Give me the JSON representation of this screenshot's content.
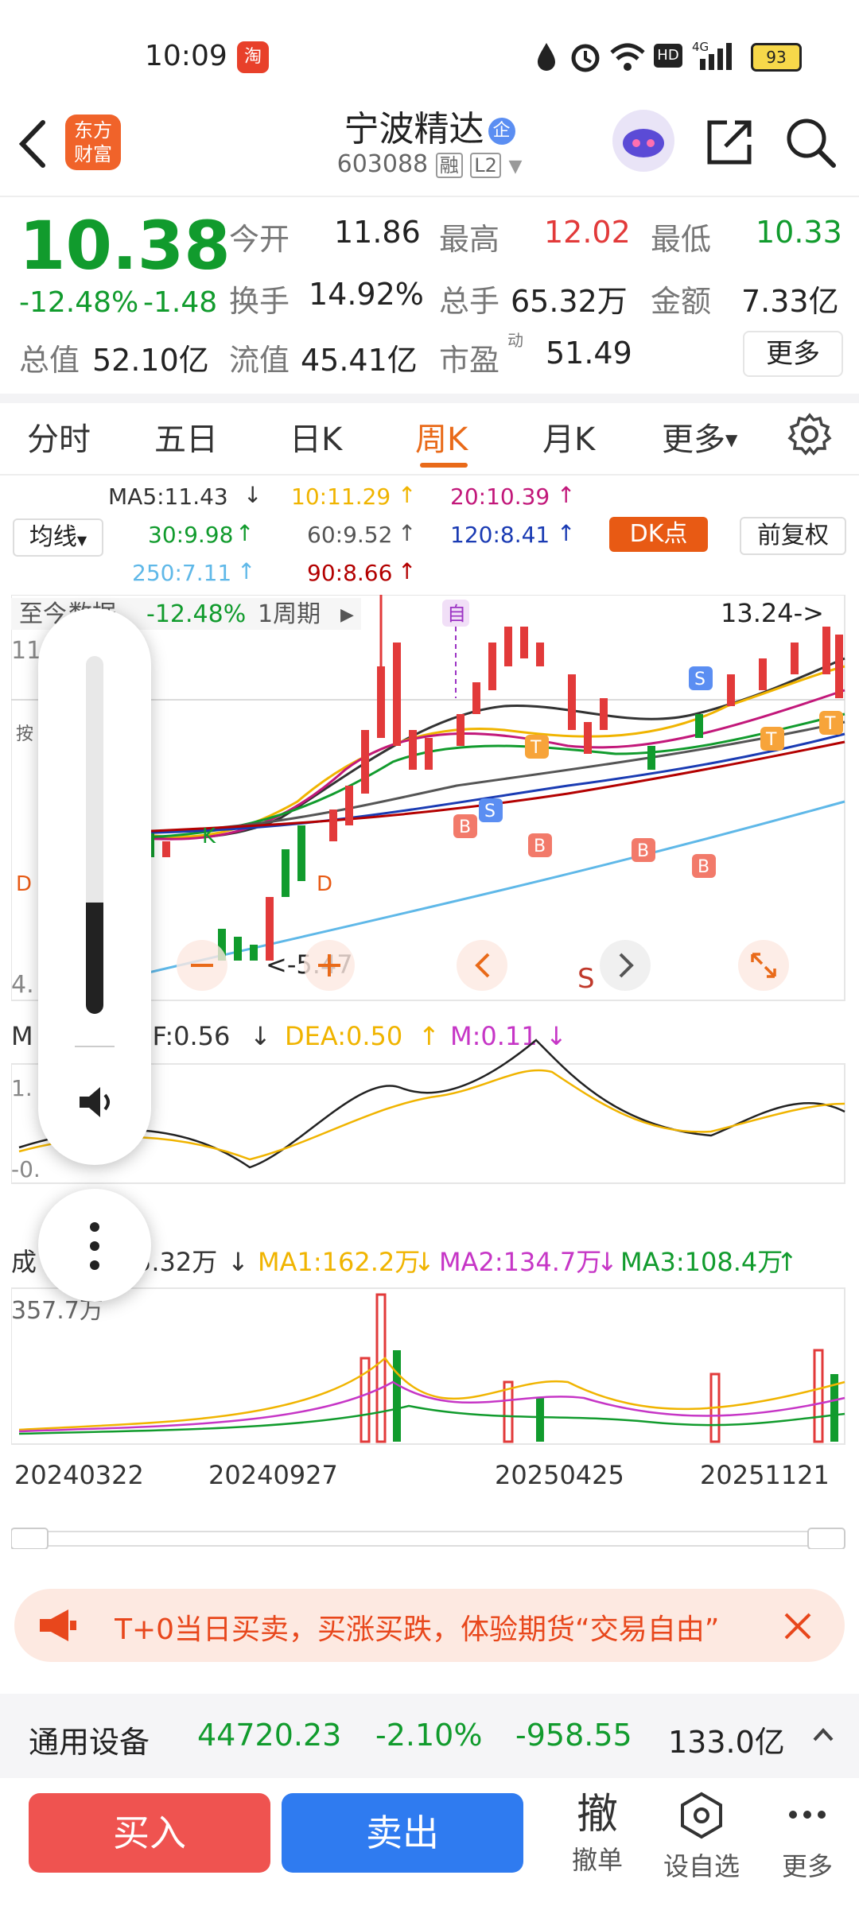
{
  "status": {
    "time": "10:09",
    "battery": "93",
    "network": "4G"
  },
  "header": {
    "back_icon": "chevron-left-icon",
    "logo_text_line1": "东方",
    "logo_text_line2": "财富",
    "title": "宁波精达",
    "title_badge": "企",
    "code": "603088",
    "tag_rong": "融",
    "tag_level": "L2"
  },
  "quote": {
    "price": "10.38",
    "change_pct": "-12.48%",
    "change": "-1.48",
    "jinkai_label": "今开",
    "jinkai": "11.86",
    "zuigao_label": "最高",
    "zuigao": "12.02",
    "zuidi_label": "最低",
    "zuidi": "10.33",
    "huanshou_label": "换手",
    "huanshou": "14.92%",
    "zongshou_label": "总手",
    "zongshou": "65.32万",
    "jine_label": "金额",
    "jine": "7.33亿",
    "zongzhi_label": "总值",
    "zongzhi": "52.10亿",
    "liuzhi_label": "流值",
    "liuzhi": "45.41亿",
    "shiying_label": "市盈",
    "shiying_sup": "动",
    "shiying": "51.49",
    "more_label": "更多"
  },
  "tabs": [
    {
      "label": "分时"
    },
    {
      "label": "五日"
    },
    {
      "label": "日K"
    },
    {
      "label": "周K",
      "active": true
    },
    {
      "label": "月K"
    },
    {
      "label": "更多"
    }
  ],
  "ma": {
    "dropdown": "均线",
    "ma5": "MA5:11.43",
    "ma10": "10:11.29",
    "ma20": "20:10.39",
    "ma30": "30:9.98",
    "ma60": "60:9.52",
    "ma120": "120:8.41",
    "ma250": "250:7.11",
    "ma90": "90:8.66",
    "dk_label": "DK点",
    "fuquan_label": "前复权"
  },
  "chart_info": {
    "range_prefix": "至今",
    "range_suffix": "数据",
    "range_pct": "-12.48%",
    "period": "1周期",
    "high_marker": "13.24->",
    "low_marker": "<-5.47",
    "y_top": "11",
    "y_bottom": "4.",
    "zi_marker": "自",
    "s_marker": "S",
    "b_marker": "B",
    "t_marker": "T",
    "k_marker": "K",
    "d_marker": "D",
    "side_label": "按"
  },
  "macd": {
    "prefix": "M",
    "dif": "IF:0.56",
    "dea": "DEA:0.50",
    "m": "M:0.11",
    "y_top": "1.",
    "y_bottom": "-0."
  },
  "volume": {
    "prefix": "成",
    "vol": "5.32万",
    "ma1": "MA1:162.2万",
    "ma2": "MA2:134.7万",
    "ma3": "MA3:108.4万",
    "y_max": "357.7万"
  },
  "dates": [
    "20240322",
    "20240927",
    "20250425",
    "20251121"
  ],
  "banner": {
    "text": "T+0当日买卖，买涨买跌，体验期货“交易自由”"
  },
  "sector": {
    "name": "通用设备",
    "index": "44720.23",
    "pct": "-2.10%",
    "change": "-958.55",
    "amount": "133.0亿"
  },
  "bottom": {
    "buy": "买入",
    "sell": "卖出",
    "cancel_big": "撤",
    "cancel": "撤单",
    "watch": "设自选",
    "more": "更多"
  },
  "colors": {
    "up": "#e23a3a",
    "down": "#119b2d",
    "accent": "#e96a19",
    "buy": "#ef5350",
    "sell": "#2f7bf0"
  }
}
